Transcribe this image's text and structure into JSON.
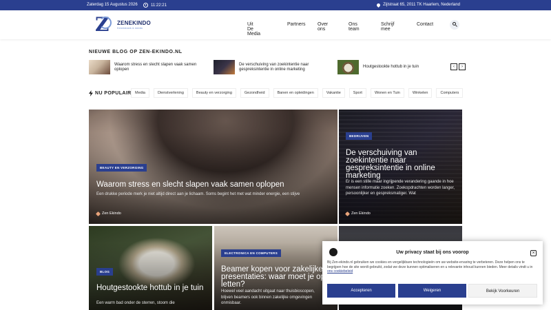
{
  "topbar": {
    "date": "Zaterdag 15 Augustus 2026",
    "time": "11:22:21",
    "address": "Zijlstraat 65, 2011 TK Haarlem, Nederland"
  },
  "logo": {
    "name": "ZENEKINDO",
    "sub": "Kennisbank & media"
  },
  "nav": [
    "Uit De Media",
    "Partners",
    "Over ons",
    "Ons team",
    "Schrijf mee",
    "Contact"
  ],
  "new_blog": {
    "title": "NIEUWE BLOG OP ZEN-EKINDO.NL",
    "items": [
      {
        "label": "Waarom stress en slecht slapen vaak samen oplopen"
      },
      {
        "label": "De verschuiving van zoekintentie naar gespreksintentie in online marketing"
      },
      {
        "label": "Houtgestookte hottub in je tuin"
      }
    ],
    "prev": "‹",
    "next": "›"
  },
  "popular": {
    "label": "NU POPULAIR",
    "tags": [
      "Media",
      "Dienstverlening",
      "Beauty en verzorging",
      "Gezondheid",
      "Banen en opleidingen",
      "Vakantie",
      "Sport",
      "Wonen en Tuin",
      "Winkelen",
      "Computers"
    ]
  },
  "cards": {
    "main": {
      "category": "BEAUTY EN VERZORGING",
      "title": "Waarom stress en slecht slapen vaak samen oplopen",
      "excerpt": "Een drukke periode merk je niet altijd direct aan je lichaam. Soms begint het met wat minder energie, een stijve",
      "author": "Zen Ekindo"
    },
    "side": {
      "category": "BEDRIJVEN",
      "title": "De verschuiving van zoekintentie naar gespreksintentie in online marketing",
      "excerpt": "Er is een stille maar ingrijpende verandering gaande in hoe mensen informatie zoeken. Zoekopdrachten worden langer, persoonlijker en gespreksmatiger. Wat",
      "author": "Zen Ekindo"
    },
    "b1": {
      "category": "BLOG",
      "title": "Houtgestookte hottub in je tuin",
      "excerpt": "Een warm bad onder de sterren, stoom die"
    },
    "b2": {
      "category": "ELECTRONICA EN COMPUTERS",
      "title": "Beamer kopen voor zakelijke presentaties: waar moet je op letten?",
      "excerpt": "Hoewel veel aandacht uitgaat naar thuisbioscopen, blijven beamers ook binnen zakelijke omgevingen onmisbaar."
    }
  },
  "cookie": {
    "title": "Uw privacy staat bij ons voorop",
    "close": "×",
    "body": "Bij Zen-ekindo.nl gebruiken we cookies en vergelijkbare technologieën om uw website-ervaring te verbeteren. Deze helpen ons te begrijpen hoe de site wordt gebruikt, zodat we deze kunnen optimaliseren en u relevante inhoud kunnen bieden. Meer details vindt u in",
    "link": "ons cookiebeleid",
    "accept": "Accepteren",
    "deny": "Weigeren",
    "prefs": "Bekijk Voorkeuren"
  },
  "colors": {
    "brand": "#2a3f8f",
    "accent": "#e7a37a"
  }
}
